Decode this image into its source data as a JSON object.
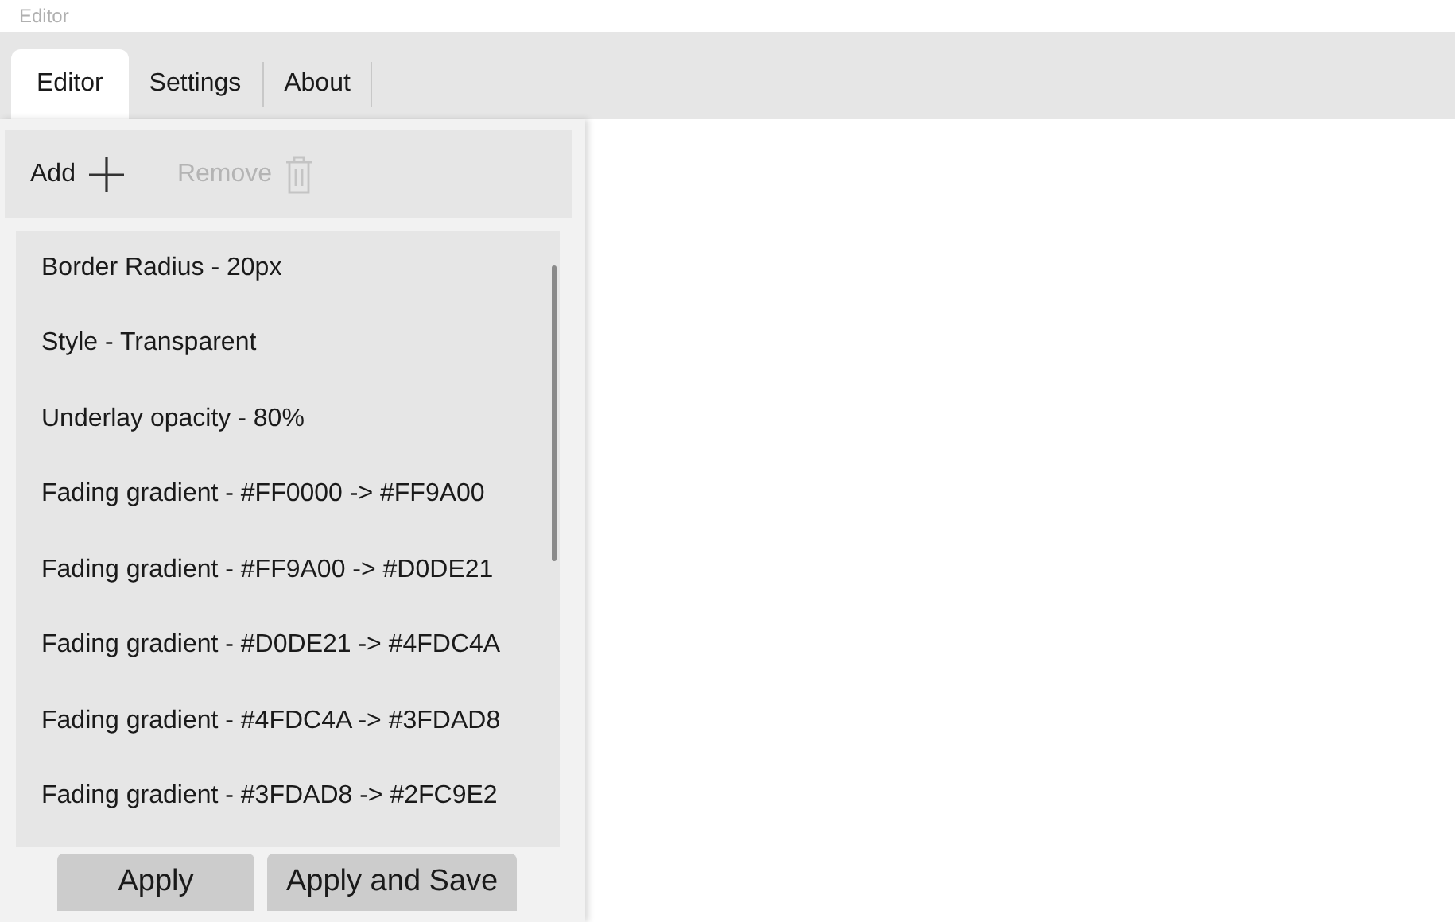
{
  "window": {
    "title": "Editor"
  },
  "tabs": [
    {
      "label": "Editor",
      "selected": true
    },
    {
      "label": "Settings",
      "selected": false
    },
    {
      "label": "About",
      "selected": false
    }
  ],
  "toolbar": [
    {
      "label": "Add",
      "kind": "add",
      "disabled": false
    },
    {
      "label": "Remove",
      "kind": "remove",
      "disabled": true
    }
  ],
  "items": [
    {
      "label": "Border Radius - 20px"
    },
    {
      "label": "Style - Transparent"
    },
    {
      "label": "Underlay opacity - 80%"
    },
    {
      "label": "Fading gradient - #FF0000 -> #FF9A00"
    },
    {
      "label": "Fading gradient - #FF9A00 -> #D0DE21"
    },
    {
      "label": "Fading gradient - #D0DE21 -> #4FDC4A"
    },
    {
      "label": "Fading gradient - #4FDC4A -> #3FDAD8"
    },
    {
      "label": "Fading gradient - #3FDAD8 -> #2FC9E2"
    }
  ],
  "buttons": [
    "Apply",
    "Apply and Save"
  ]
}
